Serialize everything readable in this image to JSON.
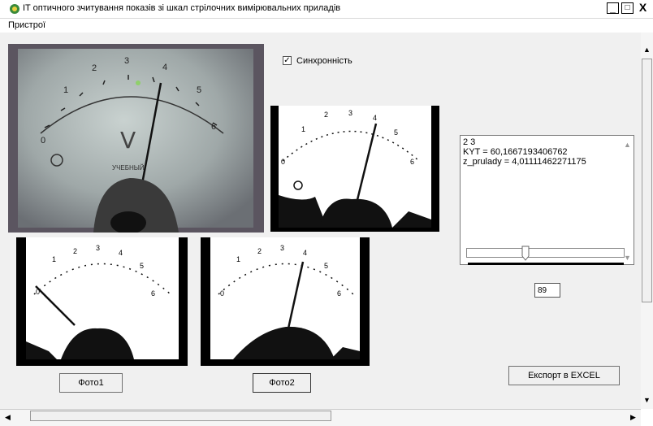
{
  "window": {
    "title": "IT оптичного зчитування показів зі шкал стрілочних вимірювальних приладів",
    "minimize": "_",
    "maximize": "□",
    "close": "X"
  },
  "menu": {
    "items": [
      {
        "label": "Пристрої"
      }
    ]
  },
  "sync": {
    "label": "Синхронність",
    "checked": true,
    "mark": "✓"
  },
  "meter": {
    "scale_labels": [
      "0",
      "1",
      "2",
      "3",
      "4",
      "5",
      "6"
    ],
    "unit_symbol": "V",
    "brand": "УЧЕБНЫЙ"
  },
  "output": {
    "lines": [
      "2  3",
      "KYT = 60,1667193406762",
      "z_prulady = 4,01111462271175"
    ]
  },
  "slider": {
    "value_text": "89"
  },
  "buttons": {
    "photo1": "Фото1",
    "photo2": "Фото2",
    "export": "Експорт в EXCEL"
  },
  "colors": {
    "title_icon": "#3a8a3a",
    "client_bg": "#f0f0f0",
    "photo_bg": "#5a5660"
  }
}
